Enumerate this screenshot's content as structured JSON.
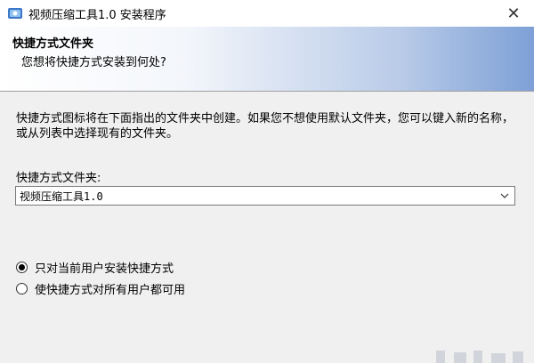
{
  "window": {
    "title": "视频压缩工具1.0 安装程序",
    "close_glyph": "✕"
  },
  "header": {
    "title": "快捷方式文件夹",
    "subtitle": "您想将快捷方式安装到何处?"
  },
  "main": {
    "description": "快捷方式图标将在下面指出的文件夹中创建。如果您不想使用默认文件夹，您可以键入新的名称，或从列表中选择现有的文件夹。",
    "folder_label": "快捷方式文件夹:",
    "folder_value": "视频压缩工具1.0",
    "options": [
      {
        "label": "只对当前用户安装快捷方式",
        "selected": true
      },
      {
        "label": "使快捷方式对所有用户都可用",
        "selected": false
      }
    ]
  },
  "icons": {
    "app": "installer-app-icon",
    "close": "close-icon",
    "dropdown": "chevron-down-icon"
  },
  "colors": {
    "banner_accent": "#7da0d6",
    "window_bg": "#f0f0f0"
  }
}
